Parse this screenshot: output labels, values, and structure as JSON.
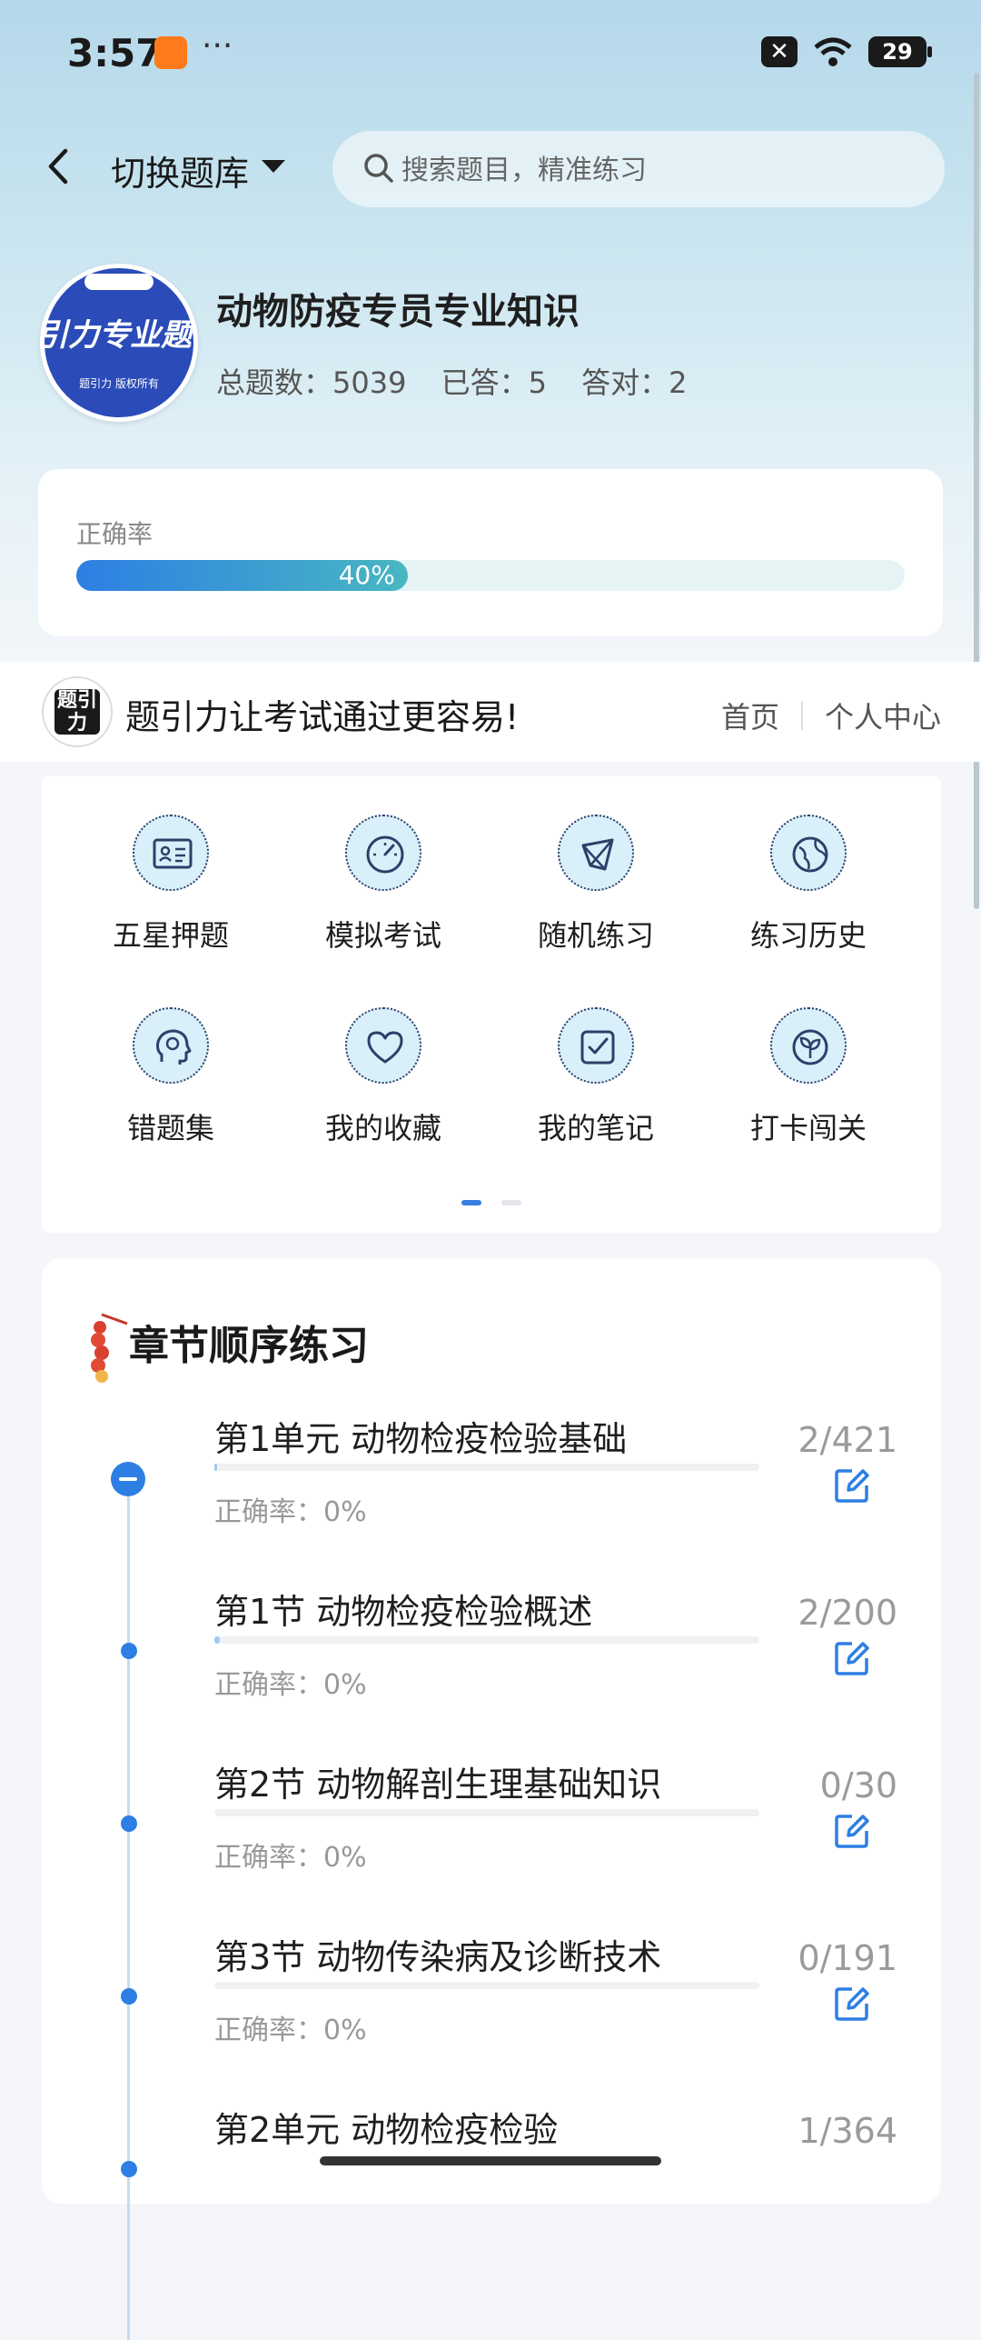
{
  "status_bar": {
    "time": "3:57",
    "dots": "···",
    "battery": "29"
  },
  "header": {
    "switch_label": "切换题库",
    "search_placeholder": "搜索题目，精准练习"
  },
  "bank": {
    "logo_text": "引力专业题",
    "logo_sub": "题引力 版权所有",
    "title": "动物防疫专员专业知识",
    "total": "总题数：5039",
    "answered": "已答：5",
    "correct": "答对：2"
  },
  "accuracy": {
    "label": "正确率",
    "percent_text": "40%",
    "value": 0.4
  },
  "banner": {
    "logo_text": "题引力",
    "slogan": "题引力让考试通过更容易!",
    "nav_home": "首页",
    "nav_profile": "个人中心"
  },
  "grid": [
    {
      "label": "五星押题",
      "icon": "id-card-icon"
    },
    {
      "label": "模拟考试",
      "icon": "gauge-icon"
    },
    {
      "label": "随机练习",
      "icon": "random-icon"
    },
    {
      "label": "练习历史",
      "icon": "globe-icon"
    },
    {
      "label": "错题集",
      "icon": "head-icon"
    },
    {
      "label": "我的收藏",
      "icon": "heart-icon"
    },
    {
      "label": "我的笔记",
      "icon": "note-check-icon"
    },
    {
      "label": "打卡闯关",
      "icon": "sprout-icon"
    }
  ],
  "chapters": {
    "title": "章节顺序练习",
    "rows": [
      {
        "title": "第1单元  动物检疫检验基础",
        "acc": "正确率：0%",
        "count": "2/421",
        "progress": 0.005
      },
      {
        "title": "第1节  动物检疫检验概述",
        "acc": "正确率：0%",
        "count": "2/200",
        "progress": 0.01
      },
      {
        "title": "第2节  动物解剖生理基础知识",
        "acc": "正确率：0%",
        "count": "0/30",
        "progress": 0
      },
      {
        "title": "第3节  动物传染病及诊断技术",
        "acc": "正确率：0%",
        "count": "0/191",
        "progress": 0
      },
      {
        "title": "第2单元  动物检疫检验",
        "acc": "",
        "count": "1/364",
        "progress": 0.003
      }
    ]
  },
  "colors": {
    "accent": "#2d7fe3",
    "logo_blue": "#2a4bb8",
    "icon_bg": "#d9f0fa"
  }
}
